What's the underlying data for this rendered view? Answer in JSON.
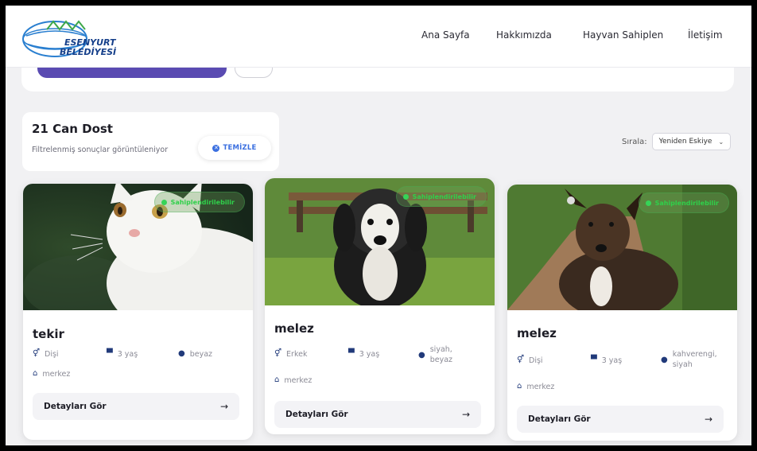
{
  "header": {
    "logo_text_line1": "ESENYURT",
    "logo_text_line2": "BELEDİYESİ",
    "nav": [
      "Ana Sayfa",
      "Hakkımızda",
      "Hayvan Sahiplen",
      "İletişim"
    ]
  },
  "results": {
    "title": "21 Can Dost",
    "subtitle": "Filtrelenmiş sonuçlar görüntüleniyor",
    "clear_label": "TEMİZLE"
  },
  "sort": {
    "label": "Sırala:",
    "value": "Yeniden Eskiye"
  },
  "colors": {
    "accent": "#5a4bb2",
    "link_blue": "#3a6fe0",
    "badge_green": "#2fd04a",
    "icon_navy": "#213a7a"
  },
  "cards": [
    {
      "name": "tekir",
      "gender": "Dişi",
      "age": "3 yaş",
      "color": "beyaz",
      "location": "merkez",
      "status": "Sahiplendirilebilir",
      "details_label": "Detayları Gör"
    },
    {
      "name": "melez",
      "gender": "Erkek",
      "age": "3 yaş",
      "color": "siyah,\nbeyaz",
      "location": "merkez",
      "status": "Sahiplendirilebilir",
      "details_label": "Detayları Gör"
    },
    {
      "name": "melez",
      "gender": "Dişi",
      "age": "3 yaş",
      "color": "kahverengi,\nsiyah",
      "location": "merkez",
      "status": "Sahiplendirilebilir",
      "details_label": "Detayları Gör"
    }
  ]
}
